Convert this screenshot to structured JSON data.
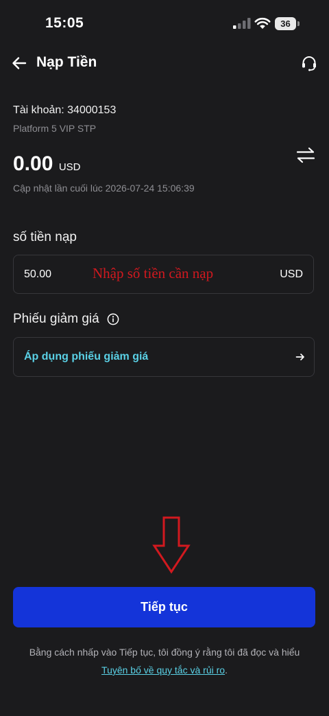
{
  "status_bar": {
    "time": "15:05",
    "battery": "36"
  },
  "header": {
    "title": "Nạp Tiền",
    "back_icon": "arrow-left-icon",
    "support_icon": "headset-icon"
  },
  "account": {
    "label": "Tài khoản: 34000153",
    "platform": "Platform 5 VIP STP",
    "balance": "0.00",
    "currency": "USD",
    "switch_icon": "swap-arrows-icon",
    "updated": "Cập nhật lần cuối lúc 2026-07-24 15:06:39"
  },
  "amount": {
    "label": "số tiền nạp",
    "value": "50.00",
    "hint": "Nhập số tiền cần nạp",
    "currency": "USD"
  },
  "voucher": {
    "label": "Phiếu giảm giá",
    "link": "Áp dụng phiếu giảm giá",
    "info_icon": "info-circle-icon",
    "arrow_icon": "arrow-right-icon"
  },
  "annotation": {
    "arrow_icon": "red-down-arrow-icon"
  },
  "actions": {
    "continue_label": "Tiếp tục"
  },
  "disclaimer": {
    "text_before": "Bằng cách nhấp vào Tiếp tục, tôi đồng ý rằng tôi đã đọc và hiểu ",
    "link_text": "Tuyên bố về quy tắc và rủi ro",
    "text_after": "."
  },
  "colors": {
    "background": "#1b1b1d",
    "primary_button": "#1434d9",
    "link": "#5ad1e6",
    "annotation_red": "#d1191f",
    "muted_text": "#8e8e93"
  }
}
